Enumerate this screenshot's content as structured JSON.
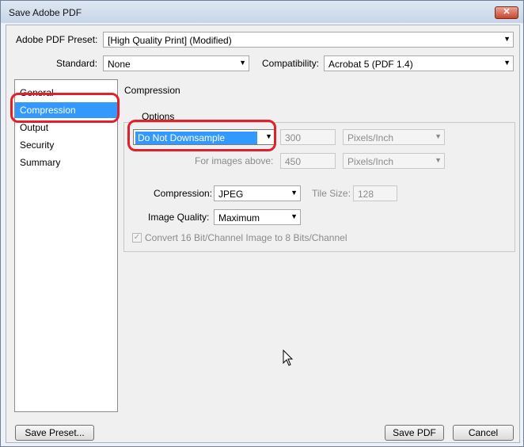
{
  "window": {
    "title": "Save Adobe PDF",
    "close_label": "✕"
  },
  "preset": {
    "label": "Adobe PDF Preset:",
    "value": "[High Quality Print] (Modified)"
  },
  "standard": {
    "label": "Standard:",
    "value": "None"
  },
  "compatibility": {
    "label": "Compatibility:",
    "value": "Acrobat 5 (PDF 1.4)"
  },
  "sidebar": {
    "items": [
      {
        "label": "General"
      },
      {
        "label": "Compression"
      },
      {
        "label": "Output"
      },
      {
        "label": "Security"
      },
      {
        "label": "Summary"
      }
    ]
  },
  "section": {
    "title": "Compression"
  },
  "options": {
    "legend": "Options",
    "downsample_value": "Do Not Downsample",
    "ppi_value": "300",
    "ppi_unit": "Pixels/Inch",
    "above_label": "For images above:",
    "above_value": "450",
    "above_unit": "Pixels/Inch",
    "compression_label": "Compression:",
    "compression_value": "JPEG",
    "tile_label": "Tile Size:",
    "tile_value": "128",
    "quality_label": "Image Quality:",
    "quality_value": "Maximum",
    "convert_label": "Convert 16 Bit/Channel Image to 8 Bits/Channel",
    "convert_check": "✓"
  },
  "buttons": {
    "save_preset": "Save Preset...",
    "save_pdf": "Save PDF",
    "cancel": "Cancel"
  },
  "colors": {
    "selection": "#3399ff",
    "highlight": "#e0202a"
  }
}
